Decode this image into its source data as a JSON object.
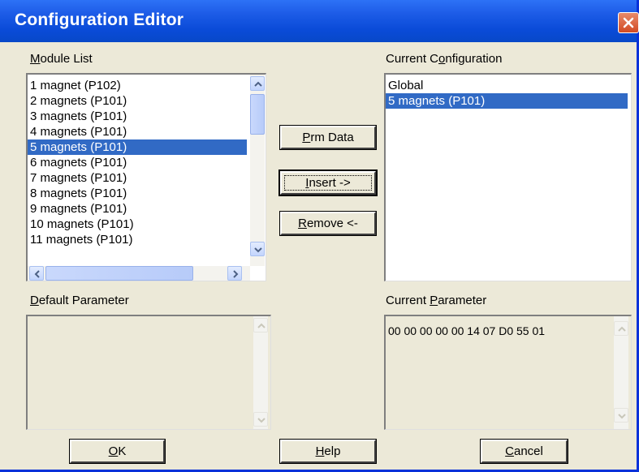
{
  "window": {
    "title": "Configuration Editor"
  },
  "module_list": {
    "label": "Module List",
    "items": [
      "1 magnet (P102)",
      "2 magnets (P101)",
      "3 magnets (P101)",
      "4 magnets (P101)",
      "5 magnets (P101)",
      "6 magnets (P101)",
      "7 magnets (P101)",
      "8 magnets (P101)",
      "9 magnets (P101)",
      "10 magnets (P101)",
      "11 magnets (P101)"
    ],
    "selected": "5 magnets (P101)"
  },
  "current_configuration": {
    "label": "Current Configuration",
    "items": [
      "Global",
      "5 magnets (P101)"
    ],
    "selected": "5 magnets (P101)"
  },
  "buttons": {
    "prm_data": "Prm Data",
    "insert": "Insert ->",
    "remove": "Remove <-",
    "ok": "OK",
    "help": "Help",
    "cancel": "Cancel"
  },
  "default_parameter": {
    "label": "Default Parameter",
    "value": ""
  },
  "current_parameter": {
    "label": "Current Parameter",
    "value": "00 00 00 00 00 14 07 D0 55 01"
  },
  "colors": {
    "titlebar": "#0a4bd8",
    "selection": "#316ac5",
    "dialog_bg": "#ece9d8",
    "close": "#d24a22"
  },
  "icons": {
    "close": "close-icon",
    "up": "arrow-up-icon",
    "down": "arrow-down-icon",
    "left": "arrow-left-icon",
    "right": "arrow-right-icon"
  }
}
